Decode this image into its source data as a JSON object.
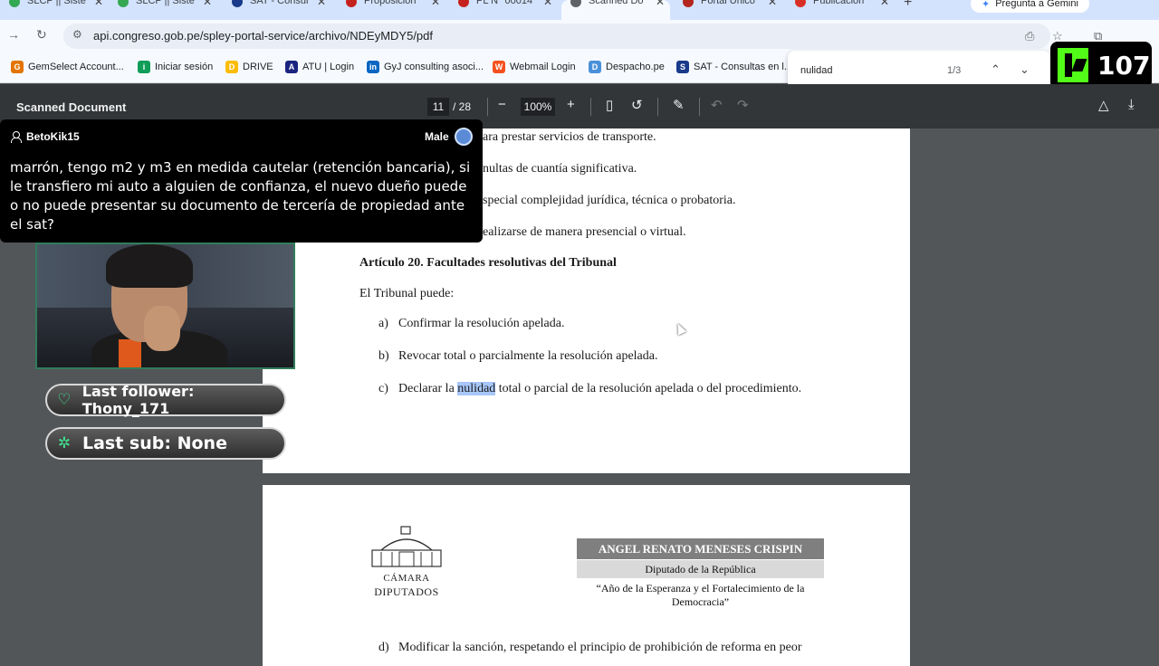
{
  "browser": {
    "tabs": [
      {
        "title": "SLCP || Siste",
        "favicon_color": "#34a853",
        "active": false
      },
      {
        "title": "SLCP || Siste",
        "favicon_color": "#34a853",
        "active": false
      },
      {
        "title": "SAT - Consul",
        "favicon_color": "#1a3a8a",
        "active": false
      },
      {
        "title": "Proposición",
        "favicon_color": "#c5221f",
        "active": false
      },
      {
        "title": "PL N° 00014",
        "favicon_color": "#c5221f",
        "active": false
      },
      {
        "title": "Scanned Do",
        "favicon_color": "#5f6368",
        "active": true
      },
      {
        "title": "Portal Único",
        "favicon_color": "#b3261e",
        "active": false
      },
      {
        "title": "Publicación",
        "favicon_color": "#d93025",
        "active": false
      }
    ],
    "new_tab": "+",
    "gemini_label": "Pregunta a Gemini",
    "url": "api.congreso.gob.pe/spley-portal-service/archivo/NDEyMDY5/pdf",
    "bookmarks": [
      {
        "label": "GemSelect Account...",
        "color": "#e37400",
        "glyph": "G"
      },
      {
        "label": "Iniciar sesión",
        "color": "#0f9d58",
        "glyph": "i"
      },
      {
        "label": "DRIVE",
        "color": "#fbbc04",
        "glyph": "D"
      },
      {
        "label": "ATU | Login",
        "color": "#1a237e",
        "glyph": "A"
      },
      {
        "label": "GyJ consulting asoci...",
        "color": "#0a66c2",
        "glyph": "in"
      },
      {
        "label": "Webmail Login",
        "color": "#f4511e",
        "glyph": "W"
      },
      {
        "label": "Despacho.pe",
        "color": "#4a90d9",
        "glyph": "D"
      },
      {
        "label": "SAT - Consultas en l...",
        "color": "#1a3a8a",
        "glyph": "S"
      }
    ]
  },
  "findbar": {
    "query": "nulidad",
    "count": "1/3"
  },
  "viewer_count": "107",
  "pdf": {
    "title": "Scanned Document",
    "page_current": "11",
    "page_total": "/ 28",
    "zoom": "100%",
    "page1_lines": [
      "ara prestar servicios de transporte.",
      "nultas de cuantía significativa.",
      "special complejidad jurídica, técnica o probatoria.",
      "ealizarse de manera presencial o virtual."
    ],
    "article_heading": "Artículo 20. Facultades resolutivas del Tribunal",
    "intro": "El Tribunal puede:",
    "items": [
      {
        "marker": "a)",
        "text": "Confirmar la resolución apelada."
      },
      {
        "marker": "b)",
        "text": "Revocar total o parcialmente la resolución apelada."
      }
    ],
    "item_c": {
      "marker": "c)",
      "before": "Declarar la ",
      "highlight": "nulidad",
      "after": " total o parcial de la resolución apelada o del procedimiento."
    },
    "letterhead": {
      "seal_line1": "CÁMARA",
      "seal_line2": "DIPUTADOS",
      "name": "ANGEL RENATO MENESES CRISPIN",
      "role": "Diputado de la República",
      "motto": "“Año de la Esperanza y el Fortalecimiento de la Democracia”"
    },
    "item_d": {
      "marker": "d)",
      "text": "Modificar la sanción, respetando el principio de prohibición de reforma en peor"
    }
  },
  "chat": {
    "username": "BetoKik15",
    "gender": "Male",
    "message": "marrón, tengo m2 y m3 en medida cautelar (retención bancaria), si le transfiero mi auto a alguien de confianza, el nuevo dueño puede o no puede presentar su documento de tercería de propiedad ante el sat?"
  },
  "alerts": {
    "follower": "Last follower: Thony_171",
    "sub": "Last sub: None"
  },
  "colors": {
    "accent": "#53fc18",
    "highlight": "#a8c7fa",
    "alert_icon": "#3fe28f"
  }
}
